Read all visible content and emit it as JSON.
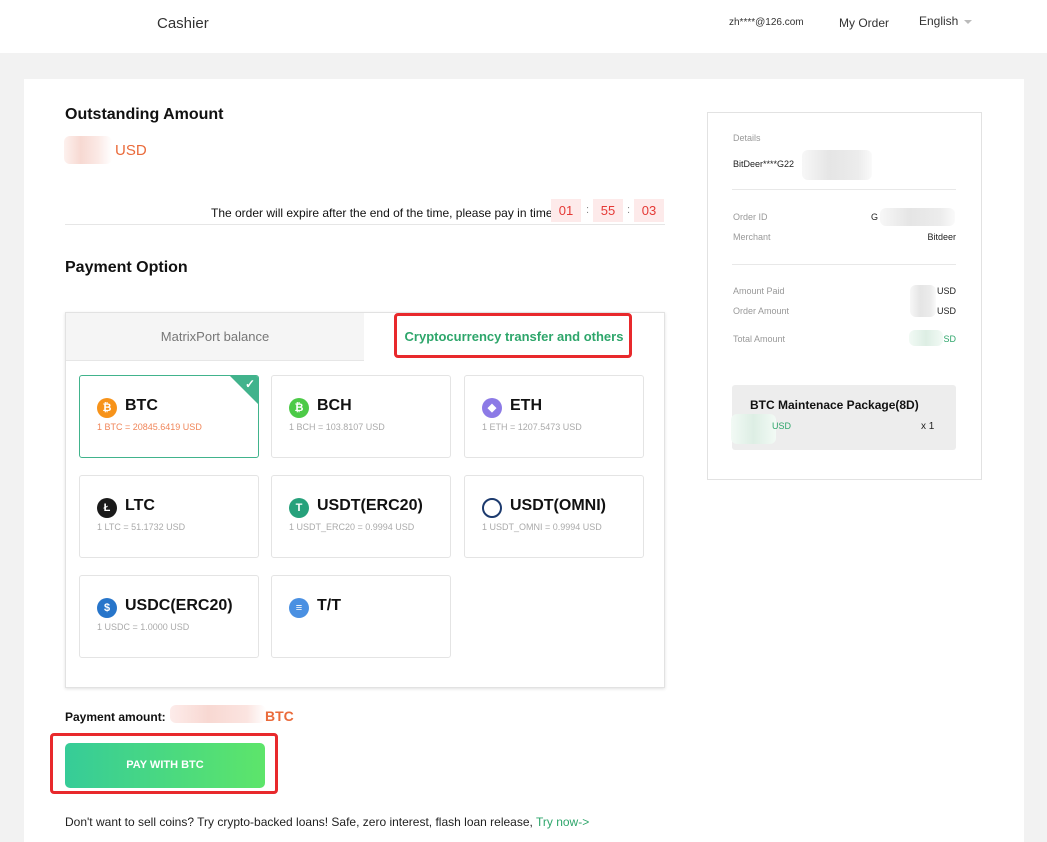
{
  "header": {
    "brand": "Cashier",
    "email": "zh****@126.com",
    "my_order": "My Order",
    "language": "English"
  },
  "outstanding": {
    "title": "Outstanding Amount",
    "currency": "USD"
  },
  "expire": {
    "text": "The order will expire after the end of the time, please pay in time",
    "hours": "01",
    "minutes": "55",
    "seconds": "03",
    "separator": ":"
  },
  "payment_option": {
    "title": "Payment Option",
    "tabs": [
      {
        "label": "MatrixPort balance",
        "active": false
      },
      {
        "label": "Cryptocurrency transfer and others",
        "active": true
      }
    ],
    "coins": [
      {
        "name": "BTC",
        "rate": "1 BTC = 20845.6419 USD",
        "icon": "bitcoin-icon",
        "color": "#f7931a",
        "glyph": "₿",
        "selected": true
      },
      {
        "name": "BCH",
        "rate": "1 BCH = 103.8107 USD",
        "icon": "bitcoin-cash-icon",
        "color": "#4cca47",
        "glyph": "₿",
        "selected": false
      },
      {
        "name": "ETH",
        "rate": "1 ETH = 1207.5473 USD",
        "icon": "ethereum-icon",
        "color": "#8c7ae6",
        "glyph": "◆",
        "selected": false
      },
      {
        "name": "LTC",
        "rate": "1 LTC = 51.1732 USD",
        "icon": "litecoin-icon",
        "color": "#1a1a1a",
        "glyph": "Ł",
        "selected": false
      },
      {
        "name": "USDT(ERC20)",
        "rate": "1 USDT_ERC20 = 0.9994 USD",
        "icon": "tether-icon",
        "color": "#26a17b",
        "glyph": "T",
        "selected": false
      },
      {
        "name": "USDT(OMNI)",
        "rate": "1 USDT_OMNI = 0.9994 USD",
        "icon": "omni-icon",
        "color": "#1c3a6e",
        "glyph": "◯",
        "selected": false
      },
      {
        "name": "USDC(ERC20)",
        "rate": "1 USDC = 1.0000 USD",
        "icon": "usdc-icon",
        "color": "#2775ca",
        "glyph": "$",
        "selected": false
      },
      {
        "name": "T/T",
        "rate": "",
        "icon": "bank-transfer-icon",
        "color": "#4a90e2",
        "glyph": "≡",
        "selected": false
      }
    ]
  },
  "payment": {
    "amount_label": "Payment amount:",
    "amount_unit": "BTC",
    "button": "PAY WITH BTC"
  },
  "promo": {
    "text": "Don't want to sell coins? Try crypto-backed loans! Safe, zero interest, flash loan release,",
    "link": "Try now->"
  },
  "details": {
    "title": "Details",
    "account": "BitDeer****G22",
    "order_id_label": "Order ID",
    "order_id_value": "G",
    "merchant_label": "Merchant",
    "merchant_value": "Bitdeer",
    "amount_paid_label": "Amount Paid",
    "amount_paid_value": "USD",
    "order_amount_label": "Order Amount",
    "order_amount_value": "USD",
    "total_amount_label": "Total Amount",
    "total_amount_value": "SD",
    "package_title": "BTC Maintenace Package(8D)",
    "package_price": "USD",
    "package_qty": "x 1"
  },
  "colors": {
    "accent_green": "#2ea66b",
    "amount_orange": "#ea6a3a",
    "timer_red": "#e53935",
    "highlight_red": "#e8292c"
  }
}
